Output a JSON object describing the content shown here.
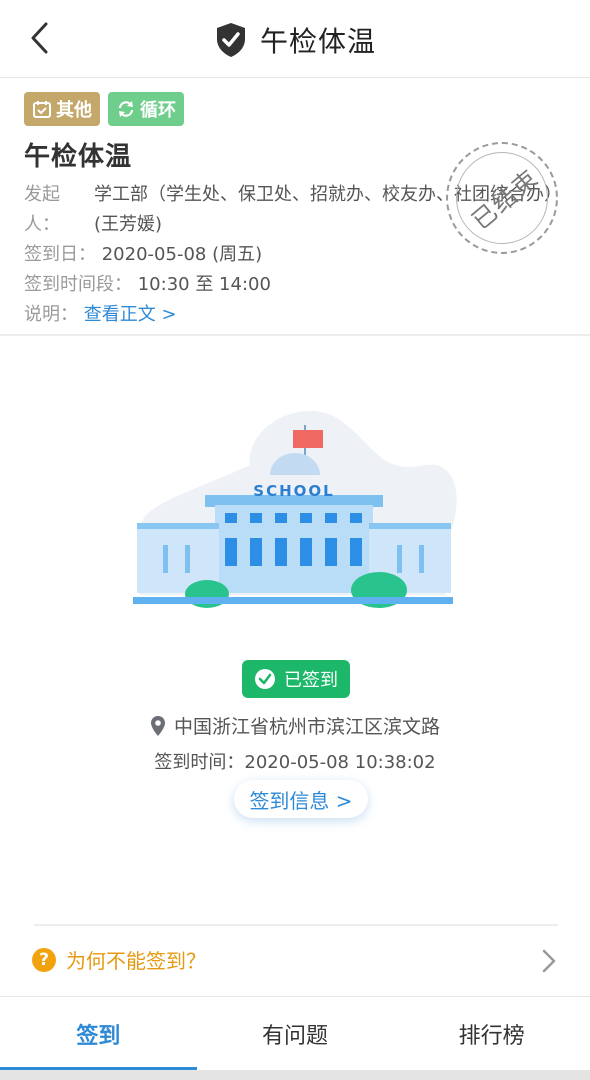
{
  "header": {
    "title": "午检体温",
    "back_icon": "chevron-left-icon",
    "title_icon": "shield-check-icon"
  },
  "task": {
    "tags": [
      {
        "label": "其他",
        "icon": "calendar-check-icon",
        "color": "#c4a76a"
      },
      {
        "label": "循环",
        "icon": "refresh-icon",
        "color": "#6fce8c"
      }
    ],
    "title": "午检体温",
    "initiator_label": "发起人：",
    "initiator_value": "学工部（学生处、保卫处、招就办、校友办、社团综合办）(王芳媛)",
    "date_label": "签到日：",
    "date_value": "2020-05-08 (周五)",
    "time_label": "签到时间段：",
    "time_value": "10:30 至 14:00",
    "desc_label": "说明：",
    "desc_link": "查看正文 >",
    "stamp_text": "已结束"
  },
  "illustration": {
    "sign_text": "SCHOOL"
  },
  "checkin": {
    "status_label": "已签到",
    "status_color": "#1cb768",
    "location": "中国浙江省杭州市滨江区滨文路",
    "time_label": "签到时间：",
    "time_value": "2020-05-08 10:38:02",
    "info_button": "签到信息 >"
  },
  "help": {
    "icon": "question-circle-icon",
    "text": "为何不能签到？"
  },
  "tabs": [
    {
      "label": "签到",
      "active": true
    },
    {
      "label": "有问题",
      "active": false
    },
    {
      "label": "排行榜",
      "active": false
    }
  ],
  "colors": {
    "accent": "#2f8ad6",
    "warning": "#e69a12"
  }
}
